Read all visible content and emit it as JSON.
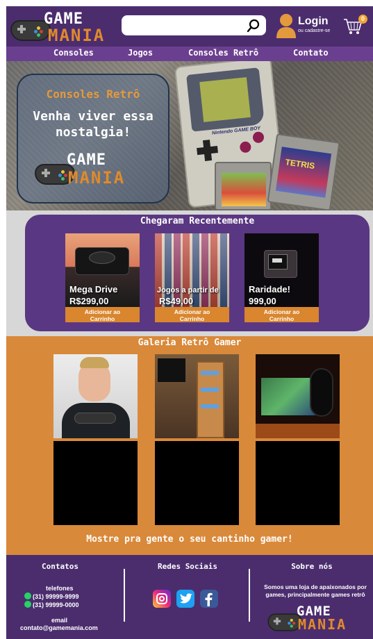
{
  "header": {
    "logo": {
      "line1": "GAME",
      "line2": "MANIA"
    },
    "search": {
      "placeholder": "",
      "value": ""
    },
    "login": {
      "title": "Login",
      "subtitle": "ou cadastre-se"
    },
    "cart": {
      "count": "0"
    }
  },
  "nav": {
    "items": [
      {
        "label": "Consoles"
      },
      {
        "label": "Jogos"
      },
      {
        "label": "Consoles Retrô"
      },
      {
        "label": "Contato"
      }
    ]
  },
  "hero": {
    "kicker": "Consoles Retrô",
    "title_line1": "Venha viver essa",
    "title_line2": "nostalgia!",
    "console_brand": "Nintendo GAME BOY",
    "cartridge_text": "TETRIS"
  },
  "arrivals": {
    "title": "Chegaram Recentemente",
    "products": [
      {
        "name": "Mega Drive",
        "price": "R$299,00",
        "button_line1": "Adicionar ao",
        "button_line2": "Carrinho"
      },
      {
        "name": "Jogos a partir de",
        "price": "R$49,00",
        "button_line1": "Adicionar ao",
        "button_line2": "Carrinho"
      },
      {
        "name": "Raridade!",
        "price": "999,00",
        "button_line1": "Adicionar ao",
        "button_line2": "Carrinho"
      }
    ]
  },
  "gallery": {
    "title": "Galeria Retrô Gamer",
    "cta": "Mostre pra gente o seu cantinho gamer!"
  },
  "footer": {
    "contacts": {
      "title": "Contatos",
      "phones_label": "telefones",
      "phone1": "(31) 99999-9999",
      "phone2": "(31) 99999-0000",
      "email_label": "email",
      "email": "contato@gamemania.com"
    },
    "social": {
      "title": "Redes Sociais",
      "icons": [
        "instagram-icon",
        "twitter-icon",
        "facebook-icon"
      ]
    },
    "about": {
      "title": "Sobre nós",
      "text_line1": "Somos uma loja de apaixonados por",
      "text_line2": "games, principalmente games retrô"
    }
  },
  "colors": {
    "primary_purple": "#4b2d6e",
    "nav_purple": "#6b3f8f",
    "panel_purple": "#5a3782",
    "accent_orange": "#d9893a"
  }
}
